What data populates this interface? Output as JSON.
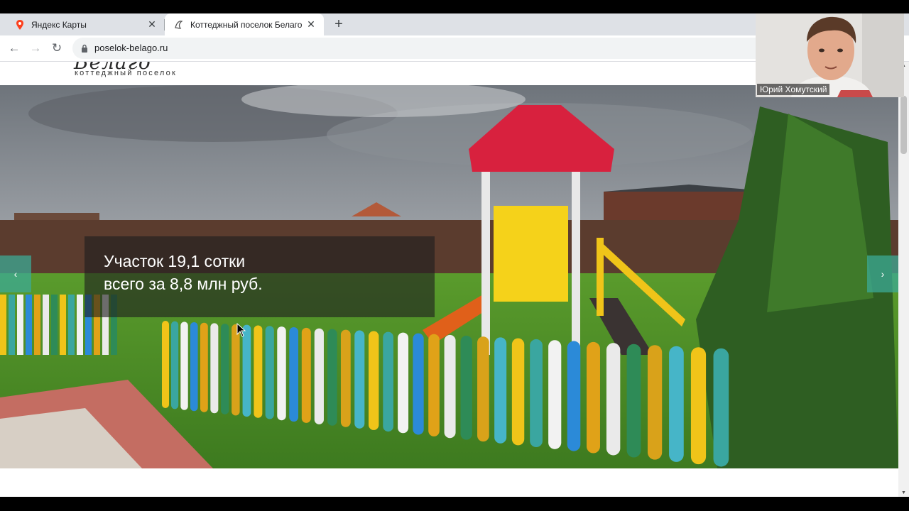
{
  "browser": {
    "tabs": [
      {
        "title": "Яндекс Карты",
        "icon": "map-pin-icon",
        "active": false
      },
      {
        "title": "Коттеджный поселок Белаго - у",
        "icon": "belago-logo-icon",
        "active": true
      }
    ],
    "new_tab": "+",
    "address": "poselok-belago.ru"
  },
  "site": {
    "logo_text": "Белаго",
    "logo_subtitle": "коттеджный поселок",
    "slide": {
      "line1": "Участок 19,1 сотки",
      "line2": "всего за 8,8 млн руб."
    },
    "prev_arrow": "‹",
    "next_arrow": "›"
  },
  "video_call": {
    "participant_name": "Юрий Хомутский"
  },
  "colors": {
    "slider_arrow": "#3caa96",
    "tab_bar": "#dee1e6"
  }
}
